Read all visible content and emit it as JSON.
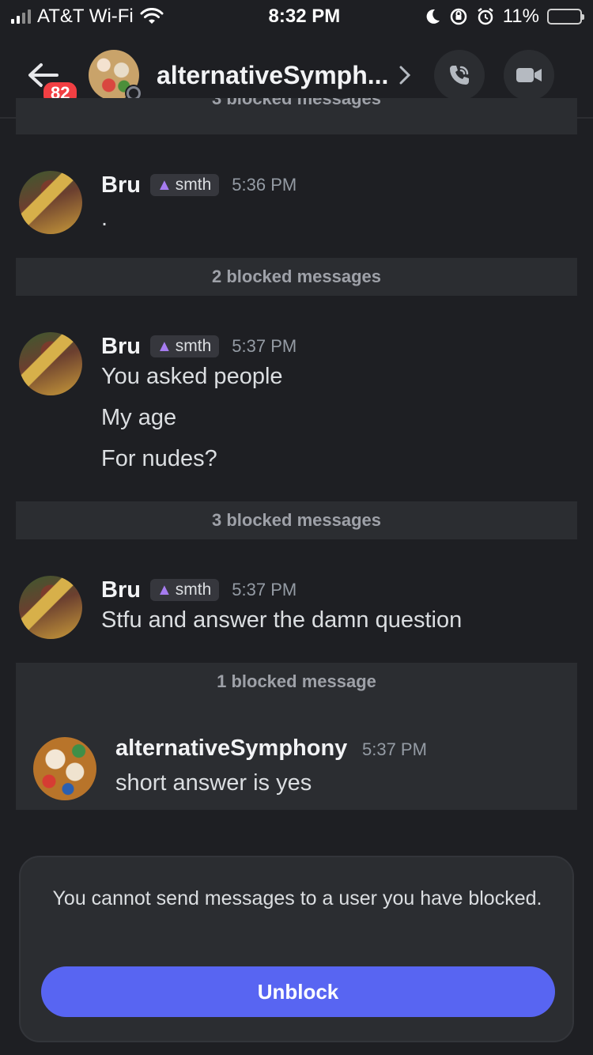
{
  "status_bar": {
    "carrier": "AT&T Wi-Fi",
    "time": "8:32 PM",
    "battery": "11%"
  },
  "header": {
    "unread_count": "82",
    "title": "alternativeSymph...",
    "icons": [
      "back-arrow-icon",
      "chevron-right-icon",
      "phone-call-icon",
      "video-camera-icon"
    ]
  },
  "messages": {
    "top_blocked_partial": "3 blocked messages",
    "group1": {
      "author": "Bru",
      "tag": "smth",
      "time": "5:36 PM",
      "lines": [
        "."
      ]
    },
    "blocked1": "2 blocked messages",
    "group2": {
      "author": "Bru",
      "tag": "smth",
      "time": "5:37 PM",
      "lines": [
        "You asked people",
        "My age",
        "For nudes?"
      ]
    },
    "blocked2": "3 blocked messages",
    "group3": {
      "author": "Bru",
      "tag": "smth",
      "time": "5:37 PM",
      "lines": [
        "Stfu and answer the damn question"
      ]
    },
    "blocked3": {
      "label": "1 blocked message",
      "author": "alternativeSymphony",
      "time": "5:37 PM",
      "text": "short answer is yes"
    }
  },
  "composer": {
    "notice": "You cannot send messages to a user you have blocked.",
    "unblock_label": "Unblock"
  },
  "colors": {
    "background": "#1e1f23",
    "blocked_bar": "#2b2d31",
    "accent": "#5865f2",
    "badge": "#f23f43"
  }
}
